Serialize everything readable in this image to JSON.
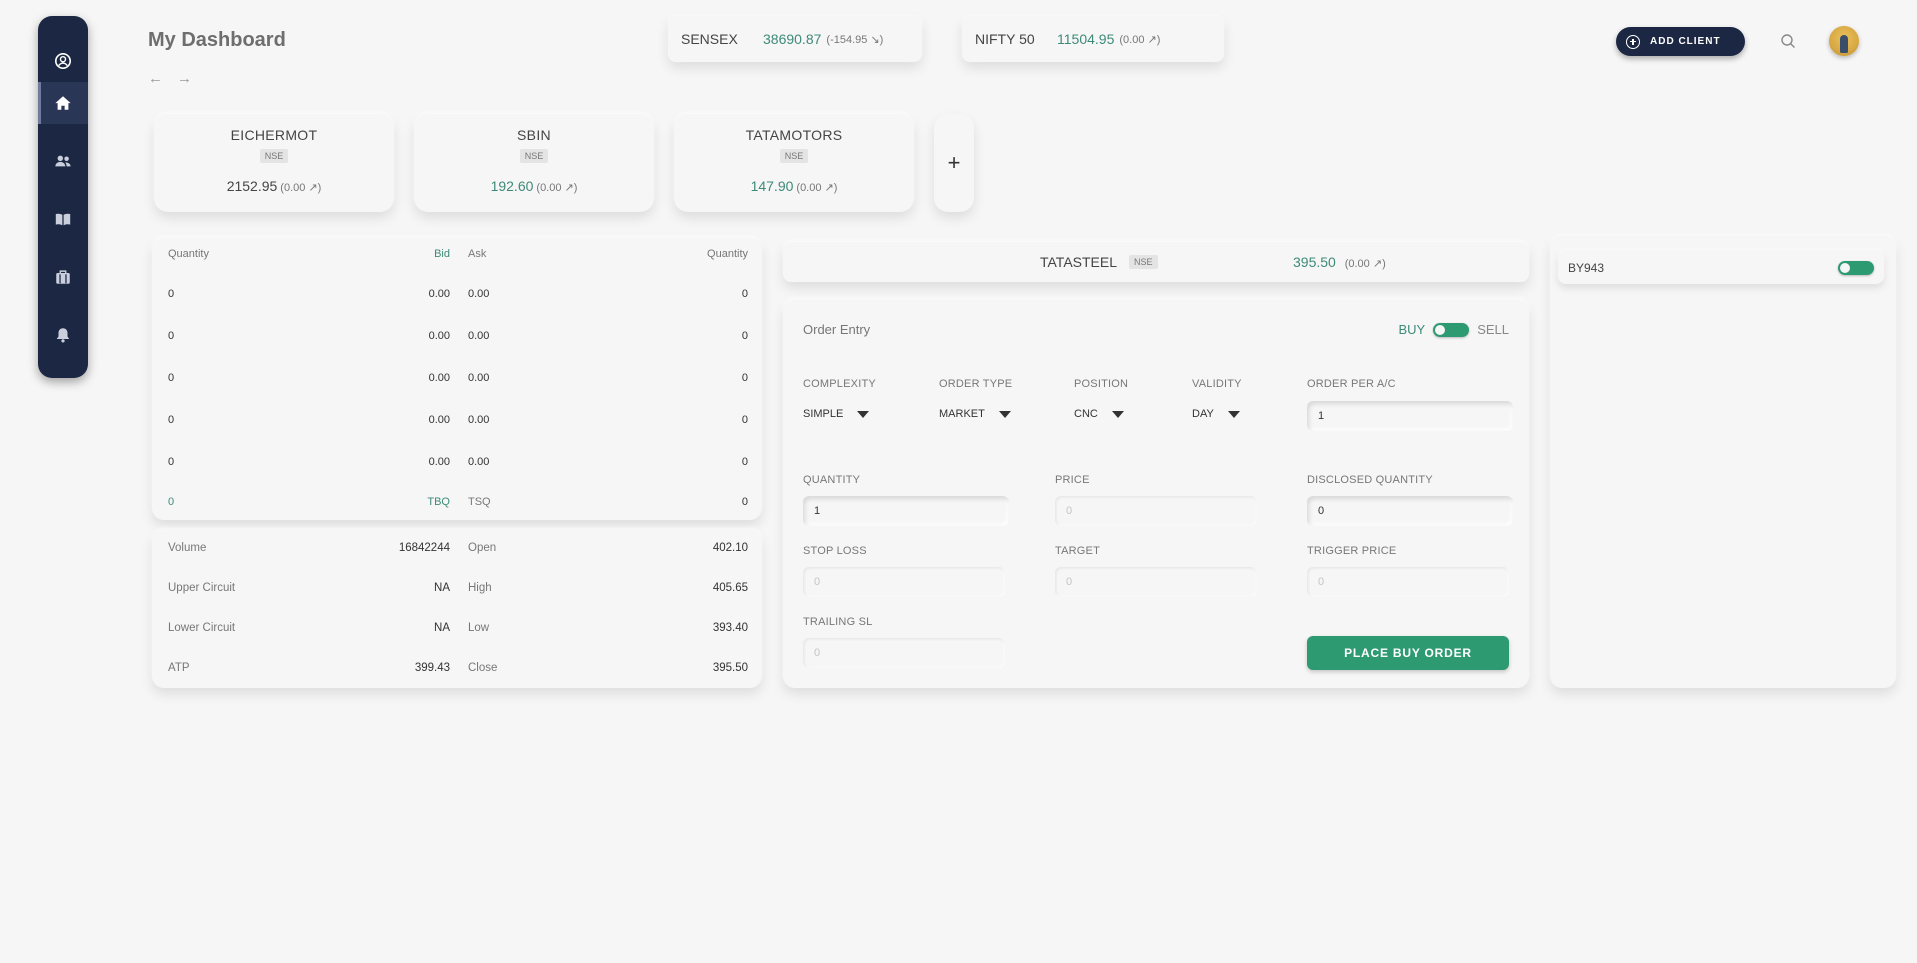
{
  "header": {
    "title": "My Dashboard",
    "back_arrow": "←",
    "forward_arrow": "→",
    "add_client_label": "ADD CLIENT"
  },
  "indices": [
    {
      "name": "SENSEX",
      "value": "38690.87",
      "change": "(-154.95 ↘)"
    },
    {
      "name": "NIFTY 50",
      "value": "11504.95",
      "change": "(0.00 ↗)"
    }
  ],
  "watchlist": [
    {
      "name": "EICHERMOT",
      "exchange": "NSE",
      "price": "2152.95",
      "change": "(0.00 ↗)"
    },
    {
      "name": "SBIN",
      "exchange": "NSE",
      "price": "192.60",
      "change": "(0.00 ↗)"
    },
    {
      "name": "TATAMOTORS",
      "exchange": "NSE",
      "price": "147.90",
      "change": "(0.00 ↗)"
    }
  ],
  "add_stock_label": "+",
  "depth": {
    "headers": {
      "qty_left": "Quantity",
      "bid": "Bid",
      "ask": "Ask",
      "qty_right": "Quantity"
    },
    "rows": [
      {
        "bid_qty": "0",
        "bid": "0.00",
        "ask": "0.00",
        "ask_qty": "0"
      },
      {
        "bid_qty": "0",
        "bid": "0.00",
        "ask": "0.00",
        "ask_qty": "0"
      },
      {
        "bid_qty": "0",
        "bid": "0.00",
        "ask": "0.00",
        "ask_qty": "0"
      },
      {
        "bid_qty": "0",
        "bid": "0.00",
        "ask": "0.00",
        "ask_qty": "0"
      },
      {
        "bid_qty": "0",
        "bid": "0.00",
        "ask": "0.00",
        "ask_qty": "0"
      }
    ],
    "totals": {
      "tbq_value": "0",
      "tbq_label": "TBQ",
      "tsq_label": "TSQ",
      "tsq_value": "0"
    }
  },
  "stats": [
    {
      "l1": "Volume",
      "v1": "16842244",
      "l2": "Open",
      "v2": "402.10"
    },
    {
      "l1": "Upper Circuit",
      "v1": "NA",
      "l2": "High",
      "v2": "405.65"
    },
    {
      "l1": "Lower Circuit",
      "v1": "NA",
      "l2": "Low",
      "v2": "393.40"
    },
    {
      "l1": "ATP",
      "v1": "399.43",
      "l2": "Close",
      "v2": "395.50"
    }
  ],
  "selected": {
    "name": "TATASTEEL",
    "exchange": "NSE",
    "price": "395.50",
    "change": "(0.00 ↗)"
  },
  "order": {
    "title": "Order Entry",
    "buy_label": "BUY",
    "sell_label": "SELL",
    "complexity_label": "COMPLEXITY",
    "complexity_value": "SIMPLE",
    "order_type_label": "ORDER TYPE",
    "order_type_value": "MARKET",
    "position_label": "POSITION",
    "position_value": "CNC",
    "validity_label": "VALIDITY",
    "validity_value": "DAY",
    "order_per_ac_label": "ORDER PER A/C",
    "order_per_ac_value": "1",
    "quantity_label": "QUANTITY",
    "quantity_value": "1",
    "price_label": "PRICE",
    "price_placeholder": "0",
    "disclosed_label": "DISCLOSED QUANTITY",
    "disclosed_value": "0",
    "stop_loss_label": "STOP LOSS",
    "stop_loss_placeholder": "0",
    "target_label": "TARGET",
    "target_placeholder": "0",
    "trigger_label": "TRIGGER PRICE",
    "trigger_placeholder": "0",
    "trailing_label": "TRAILING SL",
    "trailing_placeholder": "0",
    "place_button": "PLACE BUY ORDER"
  },
  "clients": [
    {
      "id": "BY943"
    }
  ],
  "colors": {
    "navy": "#1c2743",
    "accent_green": "#2e9a72",
    "value_green": "#3e8a78",
    "background": "#f6f6f6"
  }
}
